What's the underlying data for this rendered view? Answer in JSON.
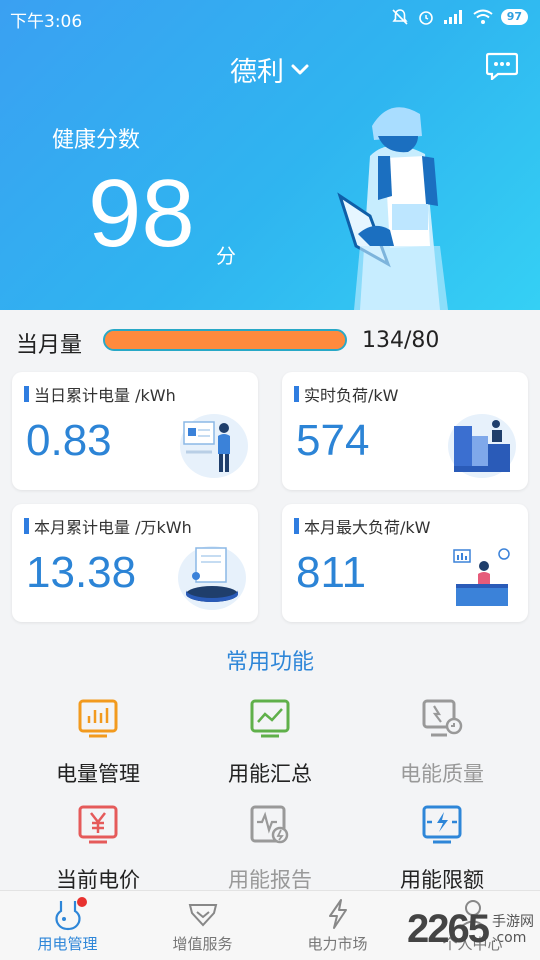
{
  "status_bar": {
    "time": "下午3:06",
    "battery": "97"
  },
  "header": {
    "site_name": "德利",
    "health_label": "健康分数",
    "health_score": "98",
    "score_unit": "分"
  },
  "month_usage": {
    "label": "当月量",
    "ratio_text": "134/80"
  },
  "cards": [
    {
      "title": "当日累计电量 /kWh",
      "value": "0.83"
    },
    {
      "title": "实时负荷/kW",
      "value": "574"
    },
    {
      "title": "本月累计电量 /万kWh",
      "value": "13.38"
    },
    {
      "title": "本月最大负荷/kW",
      "value": "811"
    }
  ],
  "functions": {
    "title": "常用功能",
    "items": [
      {
        "label": "电量管理",
        "icon": "bar-chart-icon",
        "color": "#222222"
      },
      {
        "label": "用能汇总",
        "icon": "line-chart-icon",
        "color": "#222222"
      },
      {
        "label": "电能质量",
        "icon": "monitor-icon",
        "color": "#999999"
      },
      {
        "label": "当前电价",
        "icon": "yen-icon",
        "color": "#222222"
      },
      {
        "label": "用能报告",
        "icon": "report-icon",
        "color": "#999999"
      },
      {
        "label": "用能限额",
        "icon": "bolt-limit-icon",
        "color": "#222222"
      }
    ]
  },
  "tabbar": {
    "tabs": [
      {
        "label": "用电管理"
      },
      {
        "label": "增值服务"
      },
      {
        "label": "电力市场"
      },
      {
        "label": "个人中心"
      }
    ]
  },
  "watermark": {
    "number": "2265",
    "line1": "手游网",
    "line2": ".com"
  },
  "colors": {
    "accent": "#2e86d8",
    "hero_start": "#3aa0f2",
    "hero_end": "#35d0f4",
    "progress": "#ff8a3d"
  }
}
